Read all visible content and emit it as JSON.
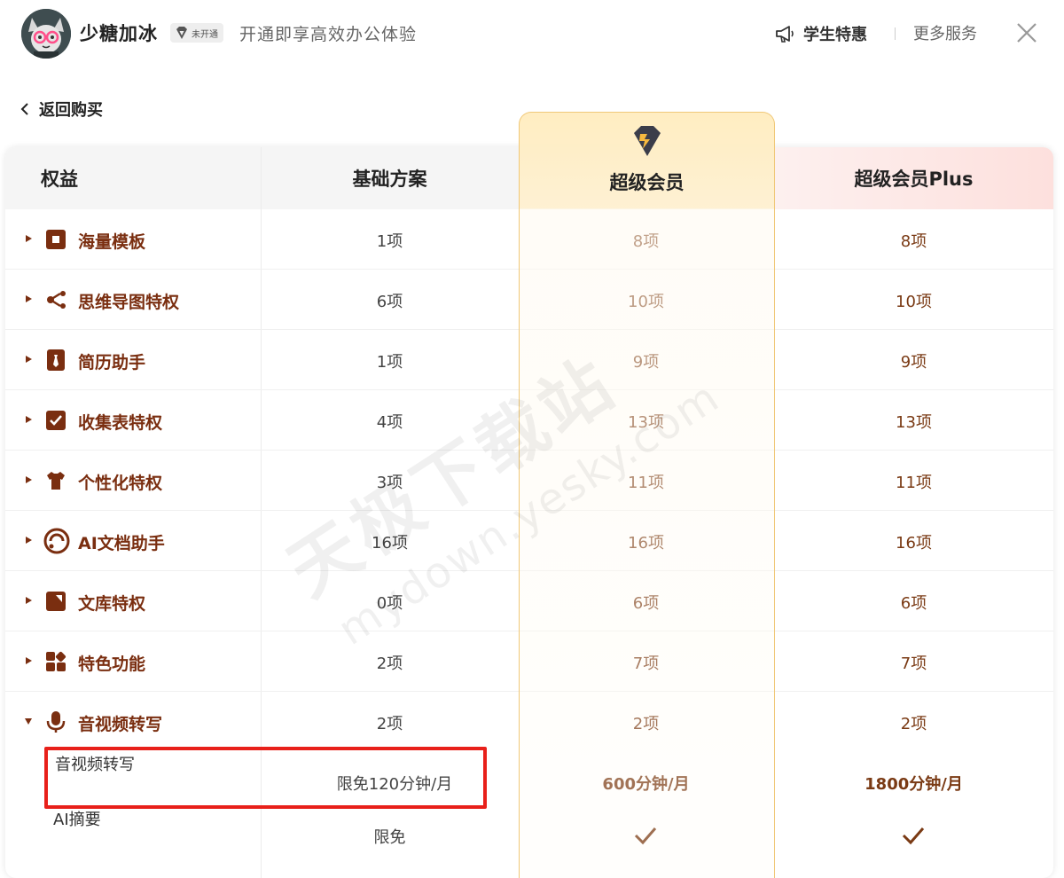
{
  "header": {
    "username": "少糖加冰",
    "badge_text": "未开通",
    "promo": "开通即享高效办公体验",
    "student_label": "学生特惠",
    "more_services": "更多服务"
  },
  "nav": {
    "back_label": "返回购买"
  },
  "table": {
    "headers": {
      "benefit": "权益",
      "basic": "基础方案",
      "super": "超级会员",
      "plus": "超级会员Plus"
    },
    "rows": [
      {
        "label": "海量模板",
        "icon": "template-icon",
        "basic": "1项",
        "super": "8项",
        "plus": "8项"
      },
      {
        "label": "思维导图特权",
        "icon": "mindmap-icon",
        "basic": "6项",
        "super": "10项",
        "plus": "10项"
      },
      {
        "label": "简历助手",
        "icon": "resume-icon",
        "basic": "1项",
        "super": "9项",
        "plus": "9项"
      },
      {
        "label": "收集表特权",
        "icon": "form-check-icon",
        "basic": "4项",
        "super": "13项",
        "plus": "13项"
      },
      {
        "label": "个性化特权",
        "icon": "shirt-icon",
        "basic": "3项",
        "super": "11项",
        "plus": "11项"
      },
      {
        "label": "AI文档助手",
        "icon": "ai-assistant-icon",
        "basic": "16项",
        "super": "16项",
        "plus": "16项"
      },
      {
        "label": "文库特权",
        "icon": "library-icon",
        "basic": "0项",
        "super": "6项",
        "plus": "6项"
      },
      {
        "label": "特色功能",
        "icon": "feature-grid-icon",
        "basic": "2项",
        "super": "7项",
        "plus": "7项"
      },
      {
        "label": "音视频转写",
        "icon": "microphone-icon",
        "basic": "2项",
        "super": "2项",
        "plus": "2项"
      }
    ],
    "sub_rows": [
      {
        "label": "音视频转写",
        "basic": "限免120分钟/月",
        "super": "600分钟/月",
        "plus": "1800分钟/月"
      },
      {
        "label": "AI摘要",
        "basic": "限免",
        "super": "check",
        "plus": "check"
      }
    ]
  },
  "watermark": {
    "main": "天极下载站",
    "sub": "mydown.yesky.com"
  },
  "colors": {
    "accent_brown": "#7a2e10",
    "gold": "#f0c878",
    "highlight_red": "#e8201a"
  }
}
